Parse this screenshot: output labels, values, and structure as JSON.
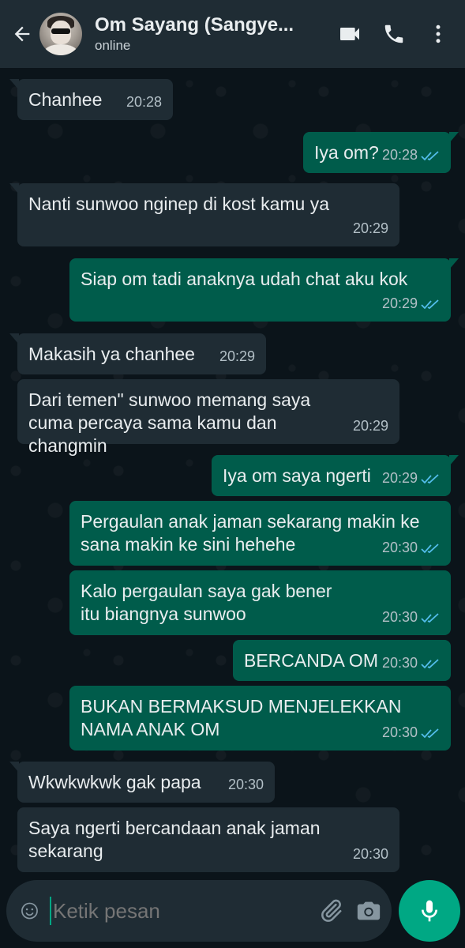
{
  "header": {
    "contact_name": "Om Sayang (Sangye...",
    "status": "online"
  },
  "messages": [
    {
      "dir": "in",
      "text": "Chanhee",
      "time": "20:28"
    },
    {
      "dir": "out",
      "text": "Iya om?",
      "time": "20:28",
      "read": true
    },
    {
      "dir": "in",
      "text": "Nanti sunwoo nginep di kost kamu ya",
      "time": "20:29"
    },
    {
      "dir": "out",
      "text": "Siap om tadi anaknya udah chat aku kok",
      "time": "20:29",
      "read": true
    },
    {
      "dir": "in",
      "text": "Makasih ya chanhee",
      "time": "20:29"
    },
    {
      "dir": "in",
      "text": "Dari temen\" sunwoo memang saya cuma percaya sama kamu dan changmin",
      "time": "20:29"
    },
    {
      "dir": "out",
      "text": "Iya om saya ngerti",
      "time": "20:29",
      "read": true
    },
    {
      "dir": "out",
      "text": "Pergaulan anak jaman sekarang makin ke sana makin ke sini hehehe",
      "time": "20:30",
      "read": true
    },
    {
      "dir": "out",
      "text": "Kalo pergaulan saya gak bener itu biangnya sunwoo",
      "time": "20:30",
      "read": true
    },
    {
      "dir": "out",
      "text": "BERCANDA OM",
      "time": "20:30",
      "read": true
    },
    {
      "dir": "out",
      "text": "BUKAN BERMAKSUD MENJELEKKAN NAMA ANAK OM",
      "time": "20:30",
      "read": true
    },
    {
      "dir": "in",
      "text": "Wkwkwkwk gak papa",
      "time": "20:30"
    },
    {
      "dir": "in",
      "text": "Saya ngerti bercandaan anak jaman sekarang",
      "time": "20:30"
    }
  ],
  "composer": {
    "placeholder": "Ketik pesan"
  },
  "icons": {
    "back": "arrow-left-icon",
    "video": "video-call-icon",
    "call": "phone-icon",
    "menu": "more-vert-icon",
    "emoji": "emoji-icon",
    "attach": "paperclip-icon",
    "camera": "camera-icon",
    "mic": "mic-icon"
  },
  "colors": {
    "header_bg": "#1f2c34",
    "chat_bg": "#0b141a",
    "incoming_bubble": "#1f2c34",
    "outgoing_bubble": "#005c4b",
    "accent": "#00a884",
    "read_tick": "#53bdeb"
  }
}
